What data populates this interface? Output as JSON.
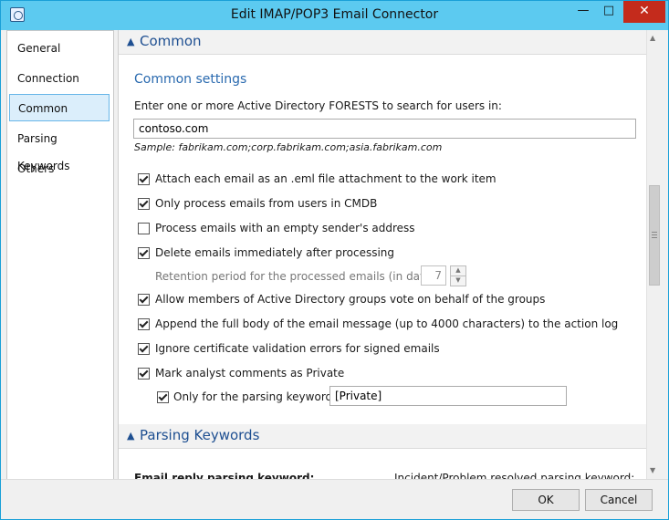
{
  "window": {
    "title": "Edit IMAP/POP3 Email Connector",
    "controls": {
      "minimize": "—",
      "maximize": "□",
      "close": "✕"
    }
  },
  "nav": {
    "items": [
      {
        "label": "General"
      },
      {
        "label": "Connection"
      },
      {
        "label": "Common",
        "selected": true
      },
      {
        "label": "Parsing Keywords"
      },
      {
        "label": "Others"
      }
    ]
  },
  "common": {
    "section_title": "Common",
    "subheading": "Common settings",
    "forests_label": "Enter one or more Active Directory FORESTS to search for users in:",
    "forests_value": "contoso.com",
    "sample_text": "Sample: fabrikam.com;corp.fabrikam.com;asia.fabrikam.com",
    "options": [
      {
        "label": "Attach each email as an .eml file attachment to the work item",
        "checked": true
      },
      {
        "label": "Only process emails from users in CMDB",
        "checked": true
      },
      {
        "label": "Process emails with an empty sender's address",
        "checked": false
      },
      {
        "label": "Delete emails immediately after processing",
        "checked": true
      },
      {
        "label": "Allow members of Active Directory groups vote on behalf of the groups",
        "checked": true
      },
      {
        "label": "Append the full body of the email message (up to 4000 characters) to the action log",
        "checked": true
      },
      {
        "label": "Ignore certificate validation errors for signed emails",
        "checked": true
      },
      {
        "label": "Mark analyst comments as Private",
        "checked": true
      }
    ],
    "retention_label": "Retention period for the processed emails (in days):",
    "retention_value": "7",
    "parsing_only_label": "Only for the parsing keyword:",
    "parsing_only_checked": true,
    "parsing_keyword_value": "[Private]"
  },
  "parsing": {
    "section_title": "Parsing Keywords",
    "reply_label": "Email reply parsing keyword:",
    "resolved_label": "Incident/Problem resolved parsing keyword:"
  },
  "footer": {
    "ok": "OK",
    "cancel": "Cancel"
  },
  "colors": {
    "accent": "#5ccaf0",
    "section_text": "#1e4f91",
    "close_red": "#c42b1c"
  }
}
